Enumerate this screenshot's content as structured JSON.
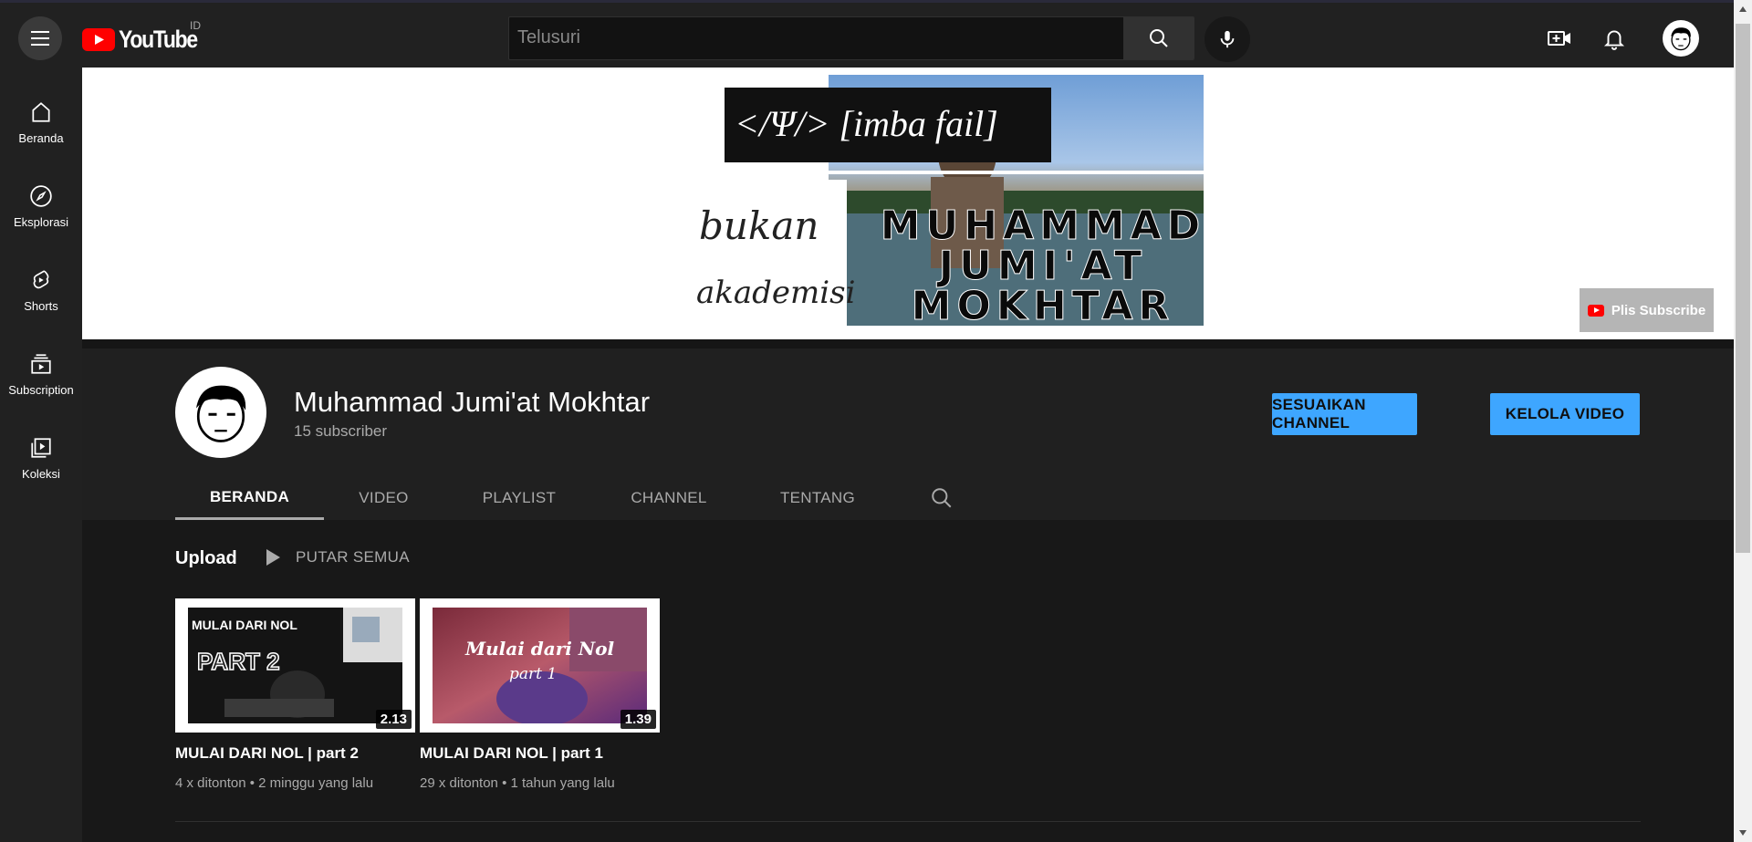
{
  "header": {
    "logo_text": "YouTube",
    "country_code": "ID",
    "search_placeholder": "Telusuri"
  },
  "sidebar": {
    "items": [
      {
        "label": "Beranda",
        "icon": "home-icon"
      },
      {
        "label": "Eksplorasi",
        "icon": "compass-icon"
      },
      {
        "label": "Shorts",
        "icon": "shorts-icon"
      },
      {
        "label": "Subscription",
        "icon": "subscriptions-icon"
      },
      {
        "label": "Koleksi",
        "icon": "library-icon"
      }
    ]
  },
  "banner": {
    "tagline": "</Ψ/>  [imba fail]",
    "script_line1": "bukan",
    "script_line2": "akademisi",
    "name_line1": "MUHAMMAD",
    "name_line2": "JUMI'AT",
    "name_line3": "MOKHTAR",
    "subscribe_watermark": "Plis Subscribe"
  },
  "channel": {
    "name": "Muhammad Jumi'at Mokhtar",
    "subscribers": "15 subscriber",
    "customize_label": "SESUAIKAN CHANNEL",
    "manage_label": "KELOLA VIDEO"
  },
  "tabs": [
    {
      "label": "BERANDA",
      "active": true
    },
    {
      "label": "VIDEO",
      "active": false
    },
    {
      "label": "PLAYLIST",
      "active": false
    },
    {
      "label": "CHANNEL",
      "active": false
    },
    {
      "label": "TENTANG",
      "active": false
    }
  ],
  "uploads": {
    "title": "Upload",
    "play_all_label": "PUTAR SEMUA",
    "videos": [
      {
        "title": "MULAI DARI NOL | part 2",
        "views": "4 x ditonton",
        "age": "2 minggu yang lalu",
        "duration": "2.13",
        "thumb_text_top": "MULAI DARI NOL",
        "thumb_text_big": "PART 2"
      },
      {
        "title": "MULAI DARI NOL | part 1",
        "views": "29 x ditonton",
        "age": "1 tahun yang lalu",
        "duration": "1.39",
        "thumb_text_top": "Mulai dari Nol",
        "thumb_text_big": "part 1"
      }
    ]
  },
  "colors": {
    "accent_blue": "#3ea6ff",
    "youtube_red": "#ff0000",
    "background": "#181818",
    "topbar": "#212121"
  }
}
